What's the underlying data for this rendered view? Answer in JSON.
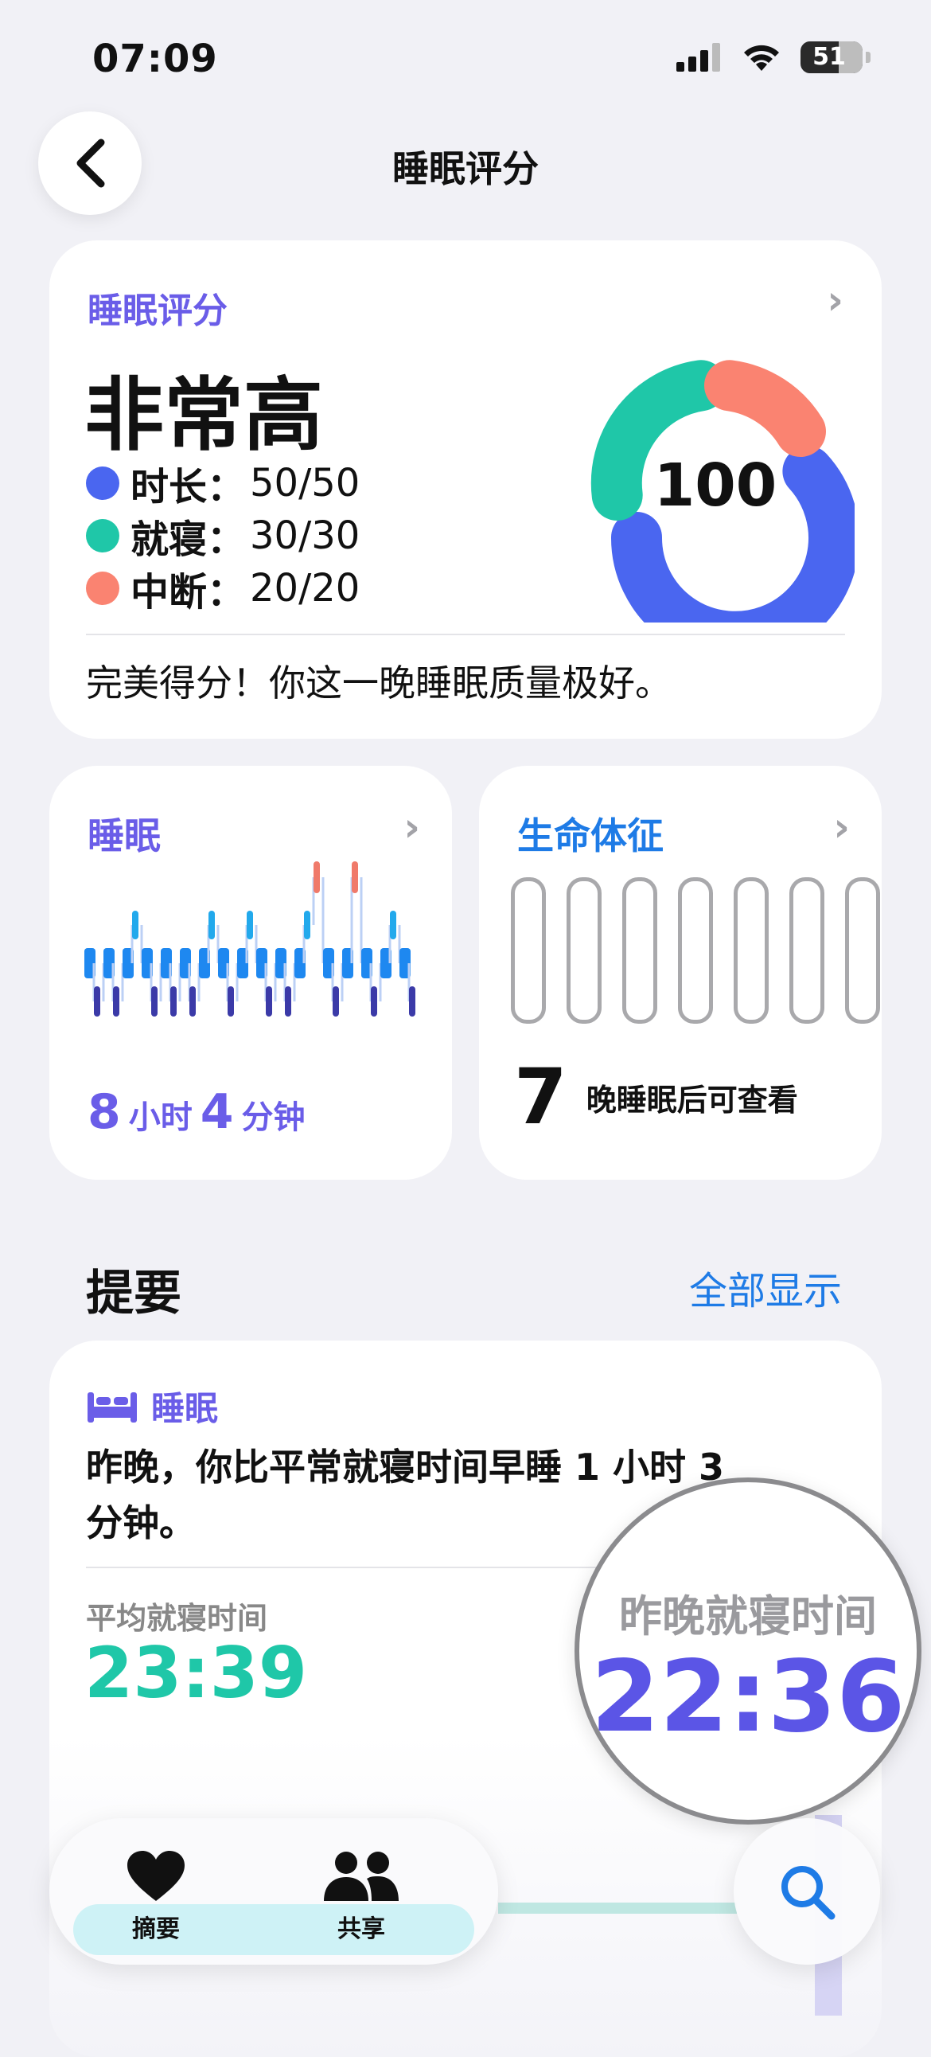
{
  "status_bar": {
    "time": "07:09",
    "battery": "51"
  },
  "nav": {
    "title": "睡眠评分"
  },
  "score_card": {
    "label": "睡眠评分",
    "level": "非常高",
    "score": "100",
    "metrics": [
      {
        "name": "时长：",
        "value": "50/50",
        "color": "#4a66f0"
      },
      {
        "name": "就寝：",
        "value": "30/30",
        "color": "#1fc7a8"
      },
      {
        "name": "中断：",
        "value": "20/20",
        "color": "#fa8371"
      }
    ],
    "summary": "完美得分！你这一晚睡眠质量极好。"
  },
  "sleep_card": {
    "label": "睡眠",
    "hours": "8",
    "hours_unit": "小时",
    "minutes": "4",
    "minutes_unit": "分钟"
  },
  "vitals_card": {
    "label": "生命体征",
    "days": "7",
    "days_text": "晚睡眠后可查看"
  },
  "highlights": {
    "title": "提要",
    "show_all": "全部显示",
    "card": {
      "category": "睡眠",
      "text": "昨晚，你比平常就寝时间早睡 1 小时 3 分钟。",
      "avg_label": "平均就寝时间",
      "avg_value": "23:39",
      "last_label": "昨晚就寝时间",
      "last_value": "22:36"
    }
  },
  "tab_bar": {
    "tabs": [
      {
        "label": "摘要",
        "icon": "heart-icon"
      },
      {
        "label": "共享",
        "icon": "people-icon"
      }
    ],
    "search_icon": "search-icon"
  },
  "colors": {
    "accent": "#6a5de8",
    "link": "#1e7be6",
    "teal": "#1fc7a8",
    "blue": "#4a66f0",
    "salmon": "#fa8371"
  }
}
